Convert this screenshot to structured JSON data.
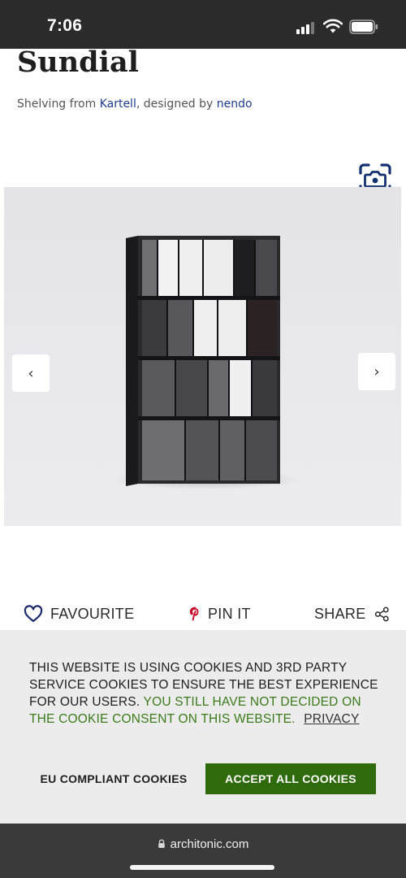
{
  "status_bar": {
    "time": "7:06"
  },
  "product": {
    "title": "Sundial",
    "subtitle_prefix": "Shelving from ",
    "brand": "Kartell",
    "subtitle_middle": ", designed by ",
    "designer": "nendo"
  },
  "gallery": {
    "image_subject": "black shelving unit with grey translucent panels",
    "prev_icon": "chevron-left-icon",
    "next_icon": "chevron-right-icon",
    "prev_glyph": "‹",
    "next_glyph": "›",
    "camera_icon": "camera-search-icon"
  },
  "actions": {
    "favourite_label": "FAVOURITE",
    "pin_label": "PIN IT",
    "share_label": "SHARE"
  },
  "cookie_banner": {
    "message": "THIS WEBSITE IS USING COOKIES AND 3RD PARTY SERVICE COOKIES TO ENSURE THE BEST EXPERIENCE FOR OUR USERS.",
    "warning": "YOU STILL HAVE NOT DECIDED ON THE COOKIE CONSENT ON THIS WEBSITE.",
    "privacy_link": "PRIVACY",
    "eu_button": "EU COMPLIANT COOKIES",
    "accept_button": "ACCEPT ALL COOKIES"
  },
  "browser": {
    "url": "architonic.com"
  },
  "colors": {
    "accent_green": "#2f6a0d",
    "warning_green": "#3c7a1a",
    "link_blue": "#1f3d8a",
    "pinterest_red": "#c8102e"
  }
}
